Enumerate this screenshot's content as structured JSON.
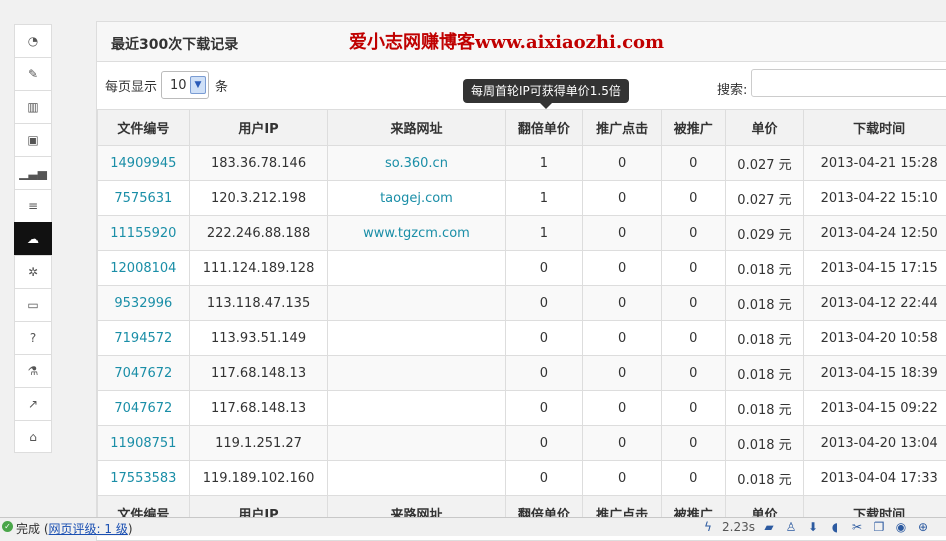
{
  "sidebar": {
    "items": [
      {
        "icon": "dashboard-icon",
        "glyph": "◔"
      },
      {
        "icon": "magic-wand-icon",
        "glyph": "✎"
      },
      {
        "icon": "bar-chart-icon",
        "glyph": "▥"
      },
      {
        "icon": "money-icon",
        "glyph": "▣"
      },
      {
        "icon": "signal-icon",
        "glyph": "▁▃▅"
      },
      {
        "icon": "list-icon",
        "glyph": "≡"
      },
      {
        "icon": "cloud-download-icon",
        "glyph": "☁",
        "active": true
      },
      {
        "icon": "gear-icon",
        "glyph": "✲"
      },
      {
        "icon": "credit-card-icon",
        "glyph": "▭"
      },
      {
        "icon": "question-icon",
        "glyph": "?"
      },
      {
        "icon": "flask-icon",
        "glyph": "⚗"
      },
      {
        "icon": "share-icon",
        "glyph": "↗"
      },
      {
        "icon": "home-icon",
        "glyph": "⌂"
      }
    ]
  },
  "panel": {
    "title": "最近300次下载记录",
    "brand": "爱小志网赚博客www.aixiaozhi.com"
  },
  "controls": {
    "per_page_label": "每页显示",
    "per_page_value": "10",
    "per_page_unit": "条",
    "search_label": "搜索:",
    "tooltip": "每周首轮IP可获得单价1.5倍"
  },
  "table": {
    "headers": [
      "文件编号",
      "用户IP",
      "来路网址",
      "翻倍单价",
      "推广点击",
      "被推广",
      "单价",
      "下载时间"
    ],
    "rows": [
      [
        "14909945",
        "183.36.78.146",
        "so.360.cn",
        "1",
        "0",
        "0",
        "0.027 元",
        "2013-04-21 15:28"
      ],
      [
        "7575631",
        "120.3.212.198",
        "taogej.com",
        "1",
        "0",
        "0",
        "0.027 元",
        "2013-04-22 15:10"
      ],
      [
        "11155920",
        "222.246.88.188",
        "www.tgzcm.com",
        "1",
        "0",
        "0",
        "0.029 元",
        "2013-04-24 12:50"
      ],
      [
        "12008104",
        "111.124.189.128",
        "",
        "0",
        "0",
        "0",
        "0.018 元",
        "2013-04-15 17:15"
      ],
      [
        "9532996",
        "113.118.47.135",
        "",
        "0",
        "0",
        "0",
        "0.018 元",
        "2013-04-12 22:44"
      ],
      [
        "7194572",
        "113.93.51.149",
        "",
        "0",
        "0",
        "0",
        "0.018 元",
        "2013-04-20 10:58"
      ],
      [
        "7047672",
        "117.68.148.13",
        "",
        "0",
        "0",
        "0",
        "0.018 元",
        "2013-04-15 18:39"
      ],
      [
        "7047672",
        "117.68.148.13",
        "",
        "0",
        "0",
        "0",
        "0.018 元",
        "2013-04-15 09:22"
      ],
      [
        "11908751",
        "119.1.251.27",
        "",
        "0",
        "0",
        "0",
        "0.018 元",
        "2013-04-20 13:04"
      ],
      [
        "17553583",
        "119.189.102.160",
        "",
        "0",
        "0",
        "0",
        "0.018 元",
        "2013-04-04 17:33"
      ]
    ]
  },
  "statusbar": {
    "done": "完成",
    "rating_prefix": "(",
    "rating_link": "网页评级: 1 级",
    "rating_suffix": ")",
    "speed": "2.23s"
  }
}
